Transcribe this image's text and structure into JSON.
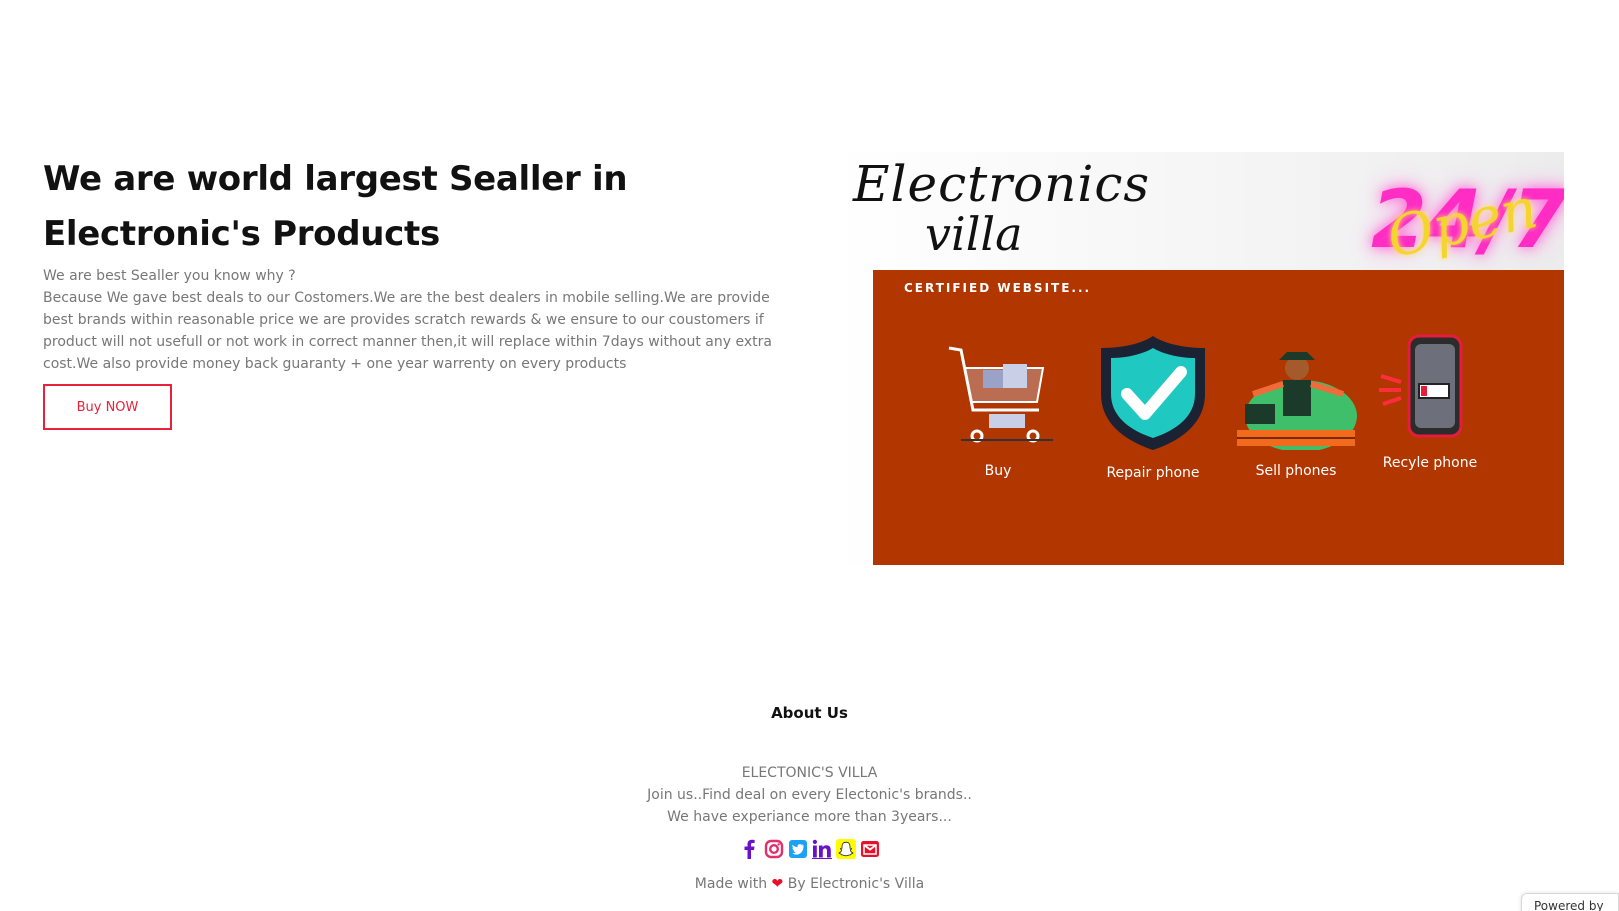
{
  "hero": {
    "title": "We are world largest Sealler in Electronic's Products",
    "lead": "We are best Sealler you know why ?",
    "body": "Because We gave best deals to our Costomers.We are the best dealers in mobile selling.We are provide best brands within reasonable price we are provides scratch rewards & we ensure to our coustomers if product will not usefull or not work in correct manner then,it will replace within 7days without any extra cost.We also provide money back guaranty + one year warrenty on every products",
    "button_label": "Buy NOW"
  },
  "banner": {
    "brand_line1": "Electronics",
    "brand_line2": "villa",
    "open_number": "24/7",
    "open_word": "Open",
    "panel_title": "CERTIFIED WEBSITE...",
    "features": [
      {
        "label": "Buy",
        "icon": "shopping-cart-icon"
      },
      {
        "label": "Repair phone",
        "icon": "shield-check-icon"
      },
      {
        "label": "Sell phones",
        "icon": "vendor-icon"
      },
      {
        "label": "Recyle phone",
        "icon": "low-battery-phone-icon"
      }
    ],
    "panel_color": "#b13600"
  },
  "about": {
    "title": "About Us",
    "line1": "ELECTONIC'S VILLA",
    "line2": "Join us..Find deal on every Electonic's brands..",
    "line3": "We have experiance more than 3years...",
    "socials": [
      {
        "icon": "facebook-icon",
        "color": "#6a11cb"
      },
      {
        "icon": "instagram-icon",
        "color": "#e1306c"
      },
      {
        "icon": "twitter-icon",
        "color": "#1da1f2"
      },
      {
        "icon": "linkedin-icon",
        "color": "#6a11cb"
      },
      {
        "icon": "snapchat-icon",
        "color": "#fffc00"
      },
      {
        "icon": "mail-icon",
        "color": "#e8102a"
      }
    ]
  },
  "footer": {
    "made_prefix": "Made with",
    "made_suffix": "By Electronic's Villa",
    "powered": "Powered by"
  },
  "colors": {
    "accent": "#e8223a",
    "text_muted": "#777777"
  }
}
